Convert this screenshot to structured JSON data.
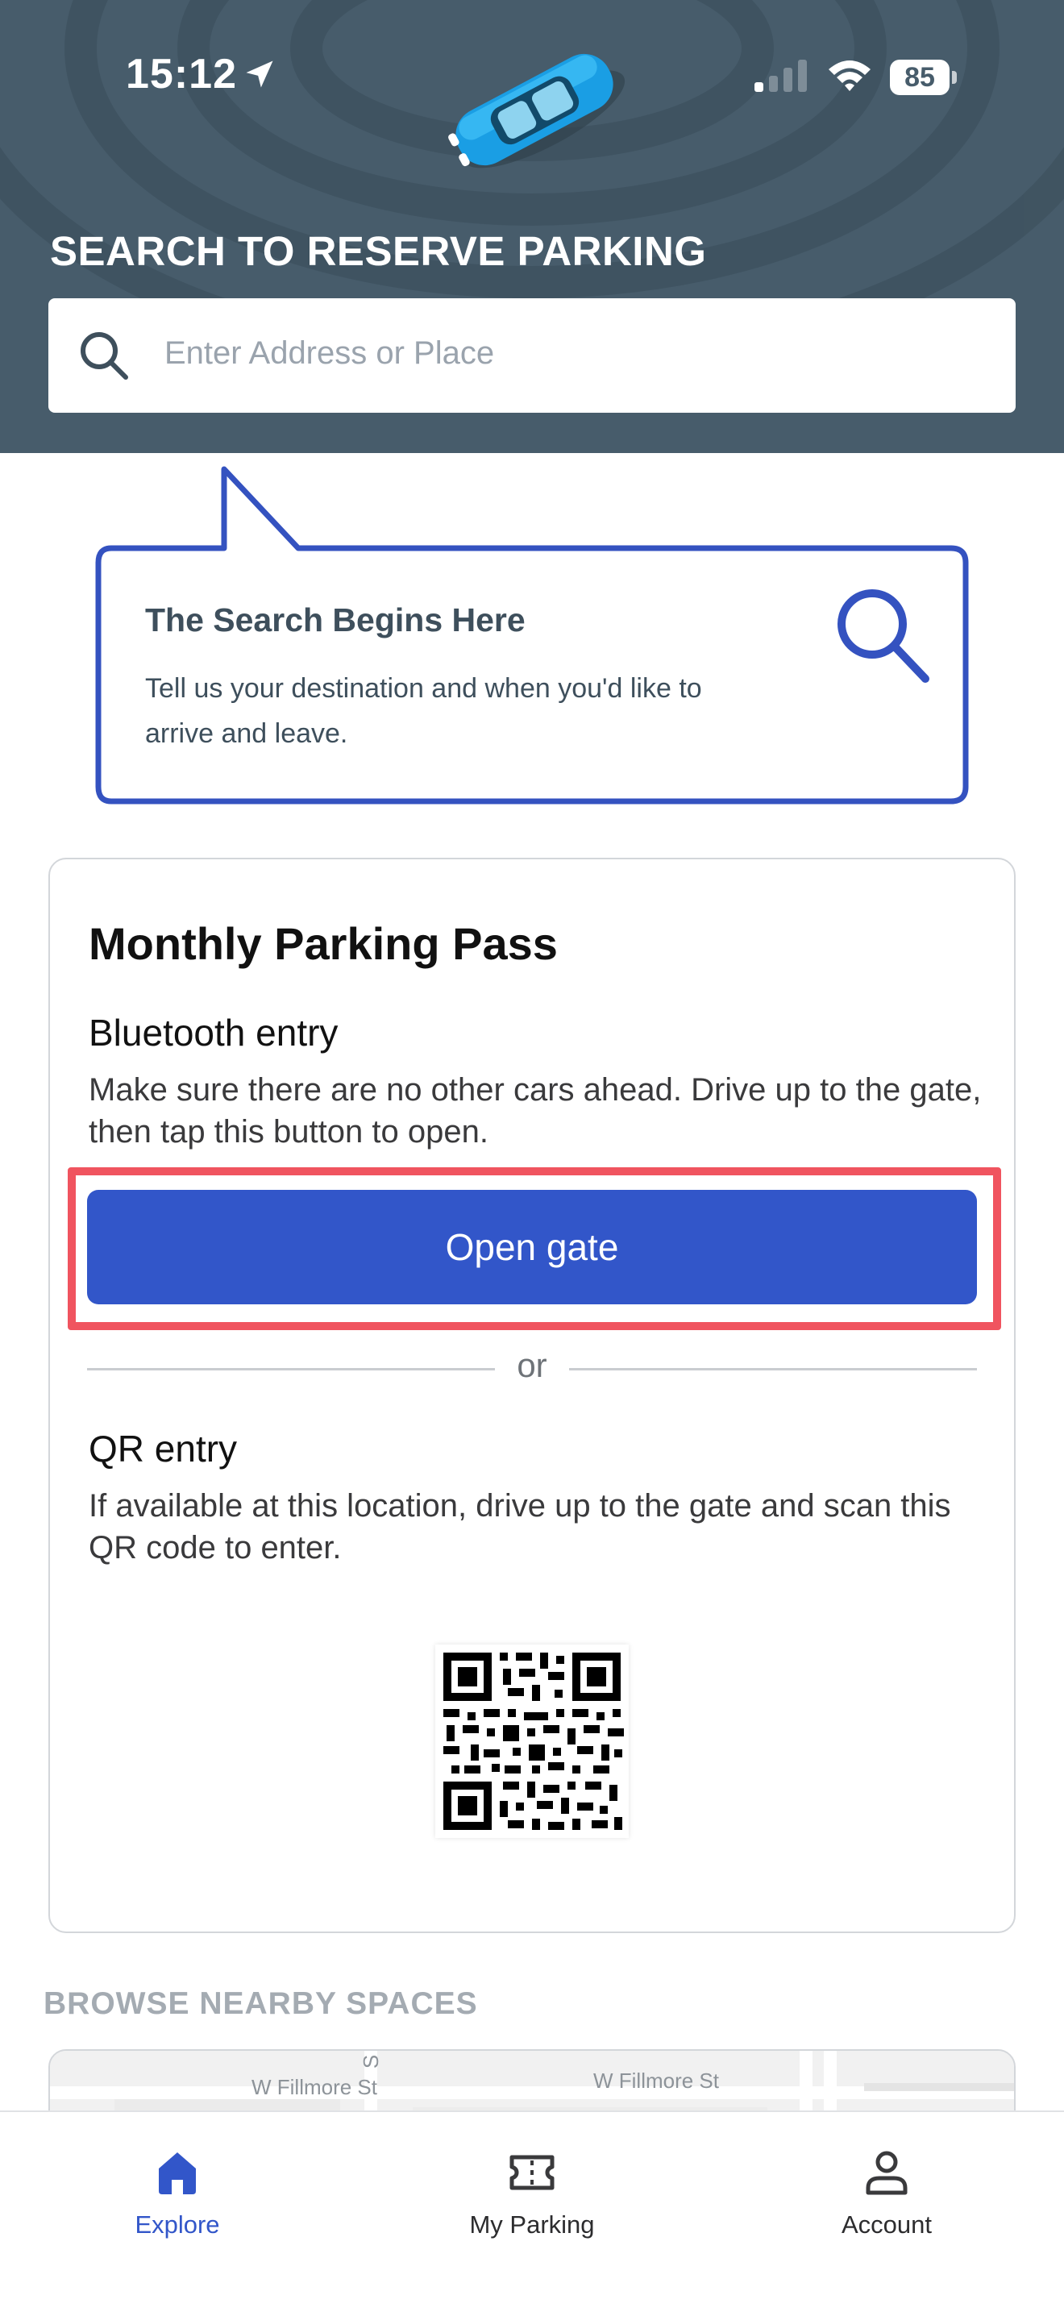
{
  "status_bar": {
    "time": "15:12",
    "battery": "85"
  },
  "header": {
    "title": "SEARCH TO RESERVE PARKING",
    "search_placeholder": "Enter Address or Place"
  },
  "callout": {
    "title": "The Search Begins Here",
    "text": "Tell us your destination and when you'd like to arrive and leave."
  },
  "pass": {
    "title": "Monthly Parking Pass",
    "bluetooth_heading": "Bluetooth entry",
    "bluetooth_text": "Make sure there are no other cars ahead. Drive up to the gate, then tap this button to open.",
    "open_gate_label": "Open gate",
    "or_label": "or",
    "qr_heading": "QR entry",
    "qr_text": "If available at this location, drive up to the gate and scan this QR code to enter."
  },
  "browse": {
    "title": "BROWSE NEARBY SPACES",
    "streets": [
      "W Fillmore St",
      "W Fillmore St",
      "S"
    ]
  },
  "tabs": [
    {
      "label": "Explore",
      "icon": "home-icon",
      "active": true
    },
    {
      "label": "My Parking",
      "icon": "ticket-icon",
      "active": false
    },
    {
      "label": "Account",
      "icon": "person-icon",
      "active": false
    }
  ],
  "colors": {
    "header_bg": "#475c6b",
    "accent": "#3256c9",
    "highlight": "#f0545f"
  }
}
